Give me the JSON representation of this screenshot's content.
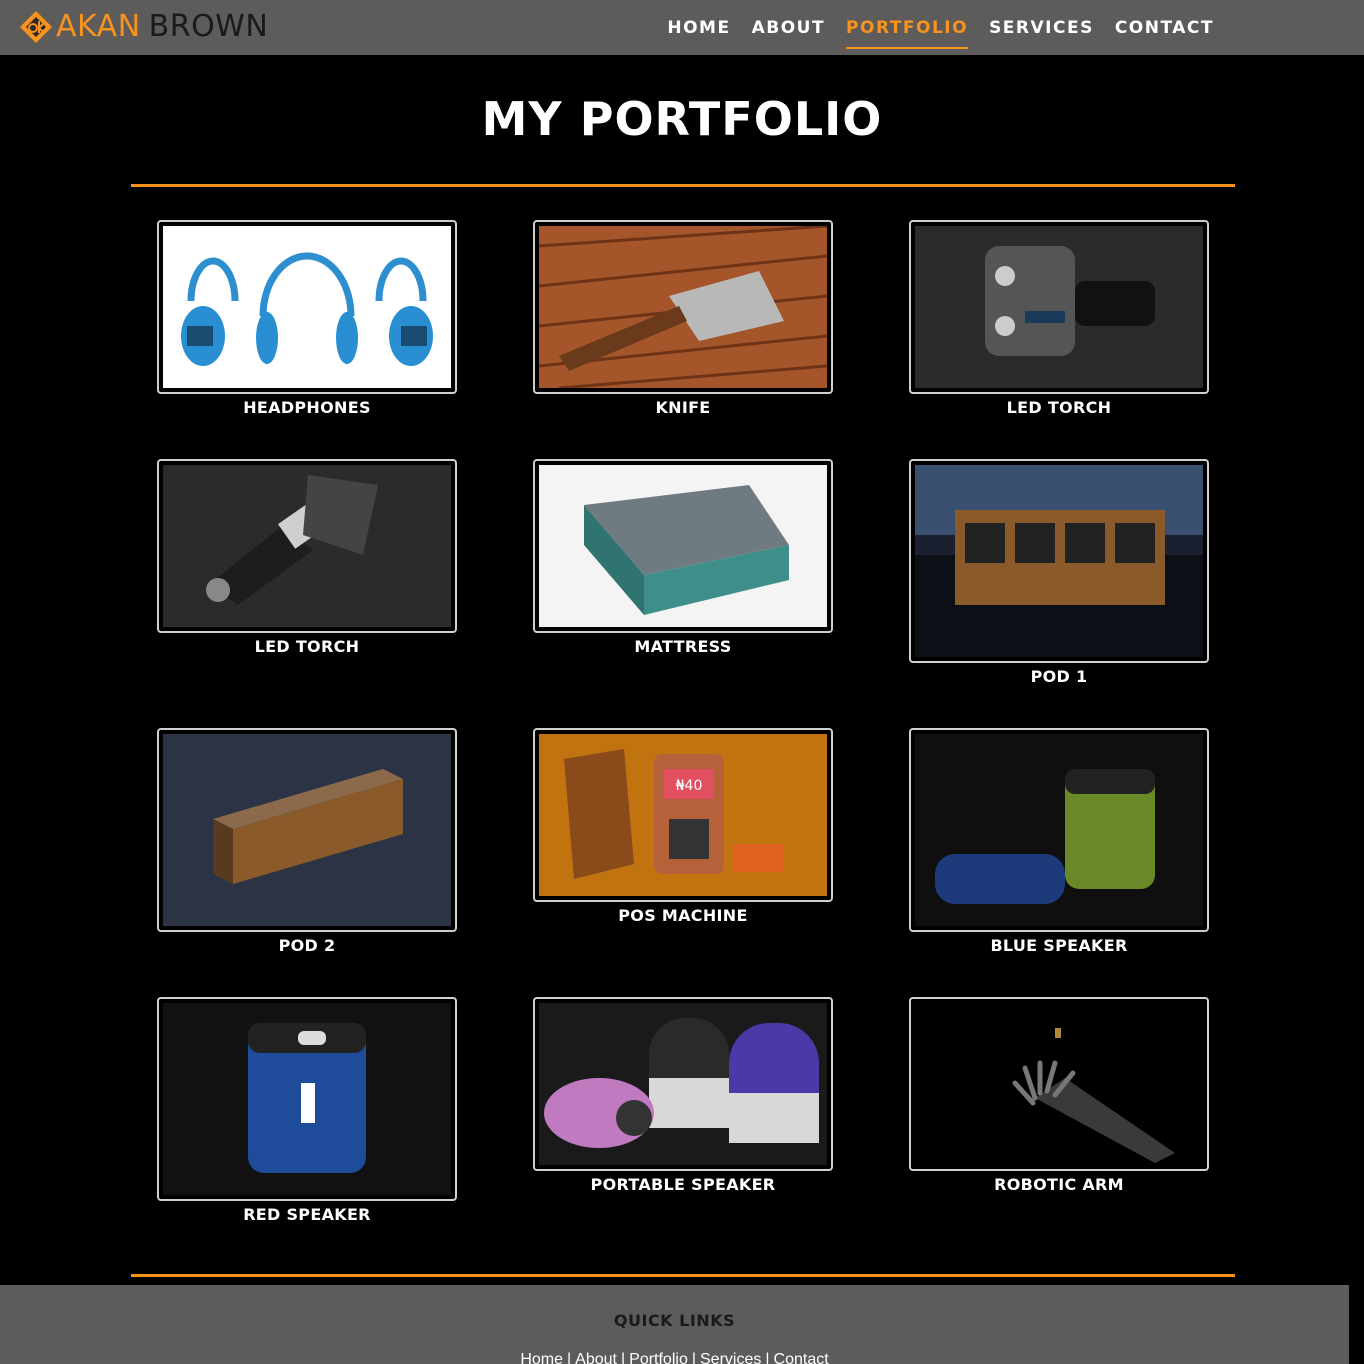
{
  "brand": {
    "word1": "AKAN",
    "word2": "BROWN"
  },
  "nav": [
    {
      "label": "HOME",
      "active": false
    },
    {
      "label": "ABOUT",
      "active": false
    },
    {
      "label": "PORTFOLIO",
      "active": true
    },
    {
      "label": "SERVICES",
      "active": false
    },
    {
      "label": "CONTACT",
      "active": false
    }
  ],
  "page_title": "MY PORTFOLIO",
  "portfolio": [
    {
      "caption": "HEADPHONES",
      "icon": "headphones-image"
    },
    {
      "caption": "KNIFE",
      "icon": "knife-image"
    },
    {
      "caption": "LED TORCH",
      "icon": "led-torch-image"
    },
    {
      "caption": "LED TORCH",
      "icon": "led-torch-image"
    },
    {
      "caption": "MATTRESS",
      "icon": "mattress-image"
    },
    {
      "caption": "POD 1",
      "icon": "pod-image"
    },
    {
      "caption": "POD 2",
      "icon": "pod-image"
    },
    {
      "caption": "POS MACHINE",
      "icon": "pos-machine-image"
    },
    {
      "caption": "BLUE SPEAKER",
      "icon": "speaker-image"
    },
    {
      "caption": "RED SPEAKER",
      "icon": "speaker-image"
    },
    {
      "caption": "PORTABLE SPEAKER",
      "icon": "portable-speaker-image"
    },
    {
      "caption": "ROBOTIC ARM",
      "icon": "robotic-arm-image"
    }
  ],
  "pos_screen_text": "₦40",
  "footer": {
    "title": "QUICK LINKS",
    "links": [
      "Home",
      "About",
      "Portfolio",
      "Services",
      "Contact"
    ],
    "separator": "|"
  },
  "colors": {
    "accent": "#f7931e",
    "navbar": "#5e5c5b",
    "background": "#000000"
  }
}
